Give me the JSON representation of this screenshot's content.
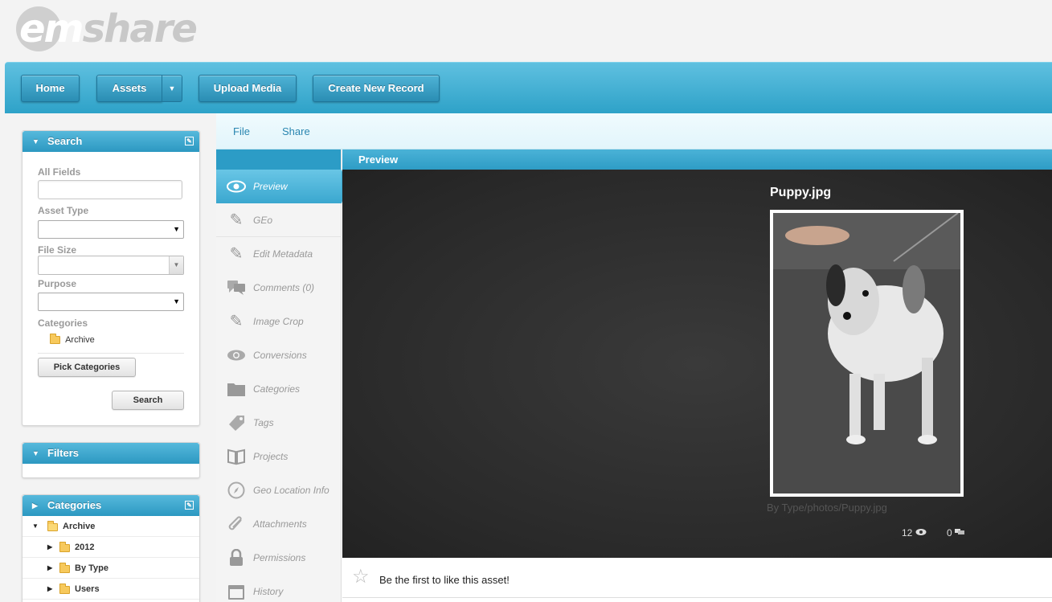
{
  "logo": {
    "text_em": "em",
    "text_share": "share"
  },
  "topnav": {
    "home": "Home",
    "assets": "Assets",
    "assets_caret": "▼",
    "upload": "Upload Media",
    "create": "Create New Record"
  },
  "search_panel": {
    "title": "Search",
    "all_fields_label": "All Fields",
    "asset_type_label": "Asset Type",
    "file_size_label": "File Size",
    "purpose_label": "Purpose",
    "categories_label": "Categories",
    "category_item": "Archive",
    "pick_categories": "Pick Categories",
    "search_button": "Search"
  },
  "filters_panel": {
    "title": "Filters"
  },
  "categories_panel": {
    "title": "Categories",
    "items": [
      {
        "label": "Archive",
        "expanded": true
      },
      {
        "label": "2012"
      },
      {
        "label": "By Type"
      },
      {
        "label": "Users"
      }
    ]
  },
  "menubar": {
    "file": "File",
    "share": "Share"
  },
  "content": {
    "header": "Preview"
  },
  "leftnav": {
    "items": [
      {
        "label": "Preview",
        "icon": "eye-icon",
        "active": true
      },
      {
        "label": "GEo",
        "icon": "pencil-icon"
      },
      {
        "label": "Edit Metadata",
        "icon": "pencil-icon"
      },
      {
        "label": "Comments (0)",
        "icon": "comments-icon"
      },
      {
        "label": "Image Crop",
        "icon": "pencil-icon"
      },
      {
        "label": "Conversions",
        "icon": "eye-icon"
      },
      {
        "label": "Categories",
        "icon": "folder-icon"
      },
      {
        "label": "Tags",
        "icon": "tag-icon"
      },
      {
        "label": "Projects",
        "icon": "book-icon"
      },
      {
        "label": "Geo Location Info",
        "icon": "compass-icon"
      },
      {
        "label": "Attachments",
        "icon": "paperclip-icon"
      },
      {
        "label": "Permissions",
        "icon": "lock-icon"
      },
      {
        "label": "History",
        "icon": "calendar-icon"
      }
    ]
  },
  "asset": {
    "title": "Puppy.jpg",
    "path": "By Type/photos/Puppy.jpg",
    "views": "12",
    "comments": "0"
  },
  "like": {
    "text": "Be the first to like this asset!"
  },
  "colors": {
    "accent": "#2c9cc6",
    "nav_gradient_top": "#5fc0e0",
    "nav_gradient_bottom": "#2ea2c8"
  }
}
